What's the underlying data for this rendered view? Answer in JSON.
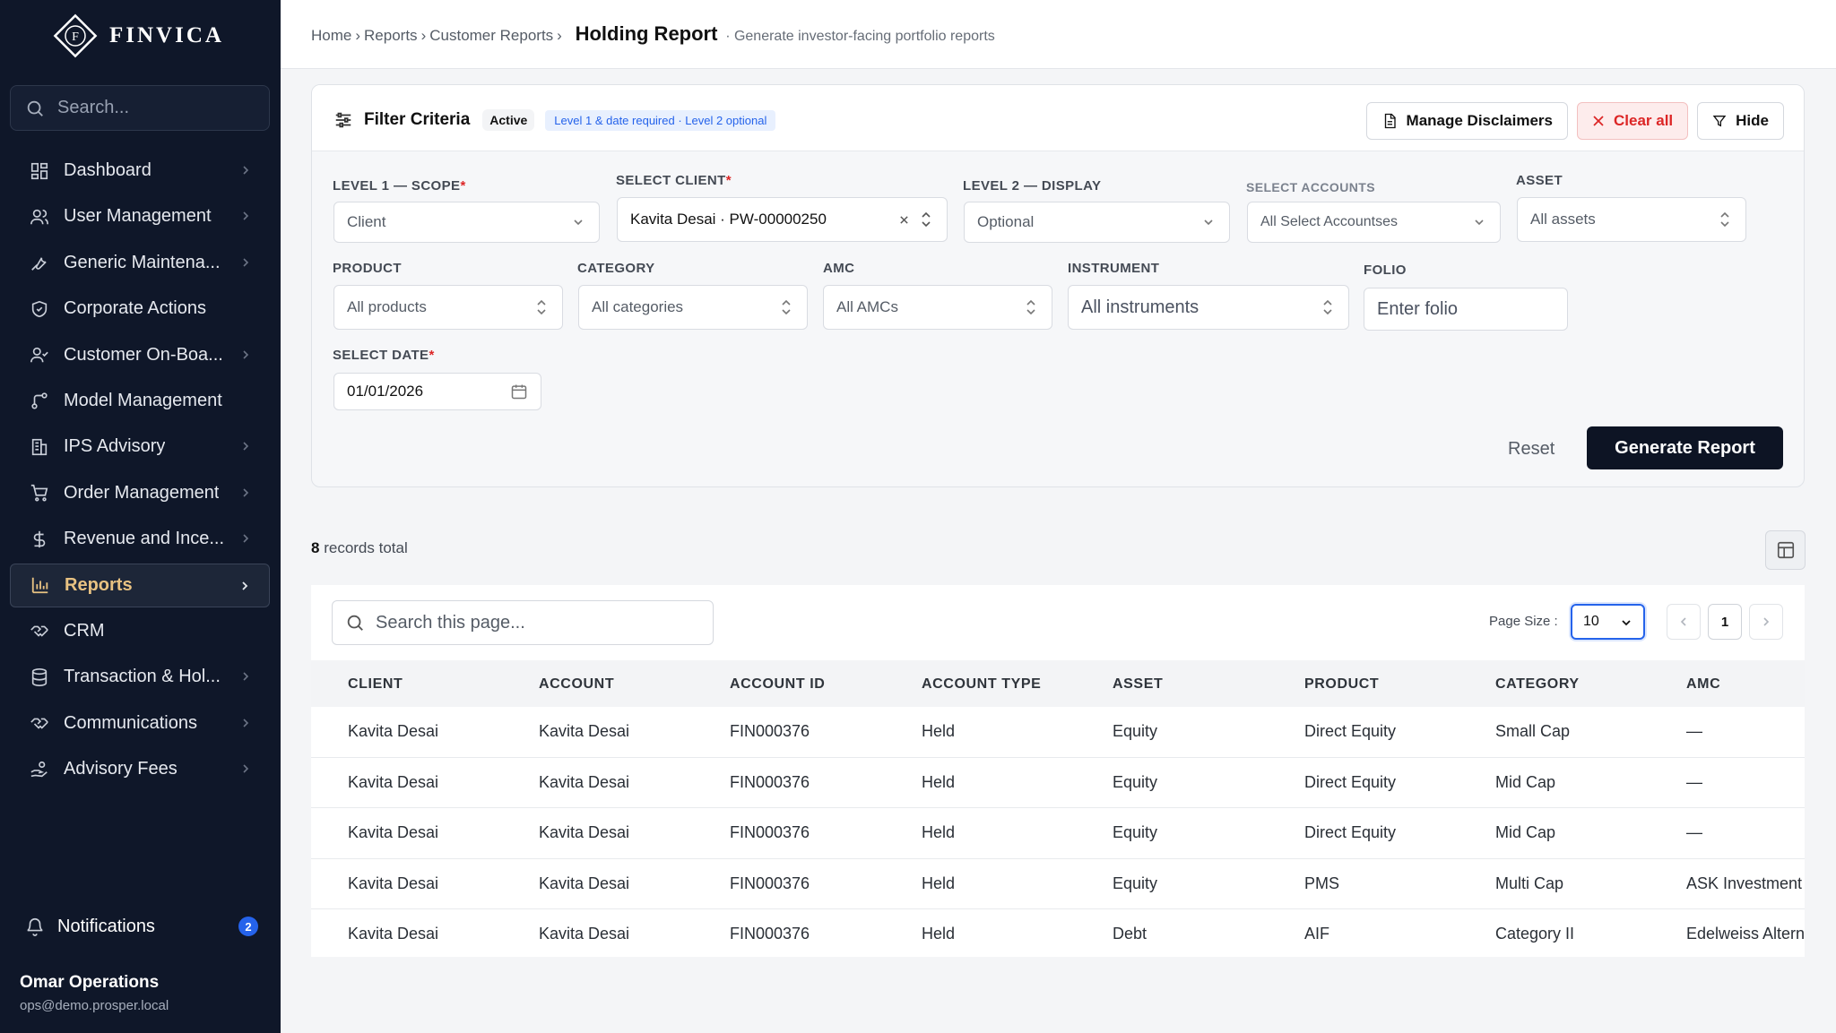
{
  "brand": {
    "name": "FINVICA",
    "mark_letter": "F"
  },
  "sidebar": {
    "search_placeholder": "Search...",
    "items": [
      {
        "label": "Dashboard",
        "icon": "grid-icon",
        "chevron": true,
        "active": false
      },
      {
        "label": "User Management",
        "icon": "users-icon",
        "chevron": true,
        "active": false
      },
      {
        "label": "Generic Maintena...",
        "icon": "wrench-icon",
        "chevron": true,
        "active": false
      },
      {
        "label": "Corporate Actions",
        "icon": "shield-icon",
        "chevron": false,
        "active": false
      },
      {
        "label": "Customer On-Boa...",
        "icon": "user-check-icon",
        "chevron": true,
        "active": false
      },
      {
        "label": "Model Management",
        "icon": "branch-icon",
        "chevron": false,
        "active": false
      },
      {
        "label": "IPS Advisory",
        "icon": "building-icon",
        "chevron": true,
        "active": false
      },
      {
        "label": "Order Management",
        "icon": "cart-icon",
        "chevron": true,
        "active": false
      },
      {
        "label": "Revenue and Ince...",
        "icon": "dollar-icon",
        "chevron": true,
        "active": false
      },
      {
        "label": "Reports",
        "icon": "bar-chart-icon",
        "chevron": true,
        "active": true
      },
      {
        "label": "CRM",
        "icon": "handshake-icon",
        "chevron": false,
        "active": false
      },
      {
        "label": "Transaction & Hol...",
        "icon": "database-icon",
        "chevron": true,
        "active": false
      },
      {
        "label": "Communications",
        "icon": "handshake-icon",
        "chevron": true,
        "active": false
      },
      {
        "label": "Advisory Fees",
        "icon": "hand-coins-icon",
        "chevron": true,
        "active": false
      }
    ],
    "notifications": {
      "label": "Notifications",
      "count": "2"
    },
    "user": {
      "name": "Omar Operations",
      "email": "ops@demo.prosper.local"
    }
  },
  "breadcrumb": {
    "items": [
      "Home",
      "Reports",
      "Customer Reports"
    ],
    "separator": "›",
    "current": "Holding Report",
    "subtitle": "· Generate investor-facing portfolio reports"
  },
  "filter": {
    "title": "Filter Criteria",
    "status": "Active",
    "hint": "Level 1 & date required · Level 2 optional",
    "actions": {
      "disclaimers": "Manage Disclaimers",
      "clear": "Clear all",
      "hide": "Hide"
    },
    "fields": {
      "level1": {
        "label": "LEVEL 1 — SCOPE",
        "required": "*",
        "value": "Client"
      },
      "client": {
        "label": "SELECT CLIENT",
        "required": "*",
        "value": "Kavita Desai · PW-00000250"
      },
      "level2": {
        "label": "LEVEL 2 — DISPLAY",
        "value": "Optional"
      },
      "accounts": {
        "label": "SELECT ACCOUNTS",
        "value": "All Select Accountses"
      },
      "asset": {
        "label": "ASSET",
        "value": "All assets"
      },
      "product": {
        "label": "PRODUCT",
        "value": "All products"
      },
      "category": {
        "label": "CATEGORY",
        "value": "All categories"
      },
      "amc": {
        "label": "AMC",
        "value": "All AMCs"
      },
      "instrument": {
        "label": "INSTRUMENT",
        "value": "All instruments"
      },
      "folio": {
        "label": "FOLIO",
        "placeholder": "Enter folio"
      },
      "date": {
        "label": "SELECT DATE",
        "required": "*",
        "value": "01/01/2026"
      }
    },
    "reset": "Reset",
    "generate": "Generate Report"
  },
  "records": {
    "count": "8",
    "suffix": "records total"
  },
  "table": {
    "search_placeholder": "Search this page...",
    "page_size_label": "Page Size :",
    "page_size": "10",
    "current_page": "1",
    "columns": [
      "CLIENT",
      "ACCOUNT",
      "ACCOUNT ID",
      "ACCOUNT TYPE",
      "ASSET",
      "PRODUCT",
      "CATEGORY",
      "AMC"
    ],
    "rows": [
      [
        "Kavita Desai",
        "Kavita Desai",
        "FIN000376",
        "Held",
        "Equity",
        "Direct Equity",
        "Small Cap",
        "—"
      ],
      [
        "Kavita Desai",
        "Kavita Desai",
        "FIN000376",
        "Held",
        "Equity",
        "Direct Equity",
        "Mid Cap",
        "—"
      ],
      [
        "Kavita Desai",
        "Kavita Desai",
        "FIN000376",
        "Held",
        "Equity",
        "Direct Equity",
        "Mid Cap",
        "—"
      ],
      [
        "Kavita Desai",
        "Kavita Desai",
        "FIN000376",
        "Held",
        "Equity",
        "PMS",
        "Multi Cap",
        "ASK Investment"
      ],
      [
        "Kavita Desai",
        "Kavita Desai",
        "FIN000376",
        "Held",
        "Debt",
        "AIF",
        "Category II",
        "Edelweiss Altern"
      ]
    ]
  },
  "colors": {
    "sidebar_bg": "#0f1729",
    "accent_gold": "#e8c282",
    "primary": "#0d1424",
    "link_blue": "#2563eb",
    "danger": "#dc2626"
  }
}
